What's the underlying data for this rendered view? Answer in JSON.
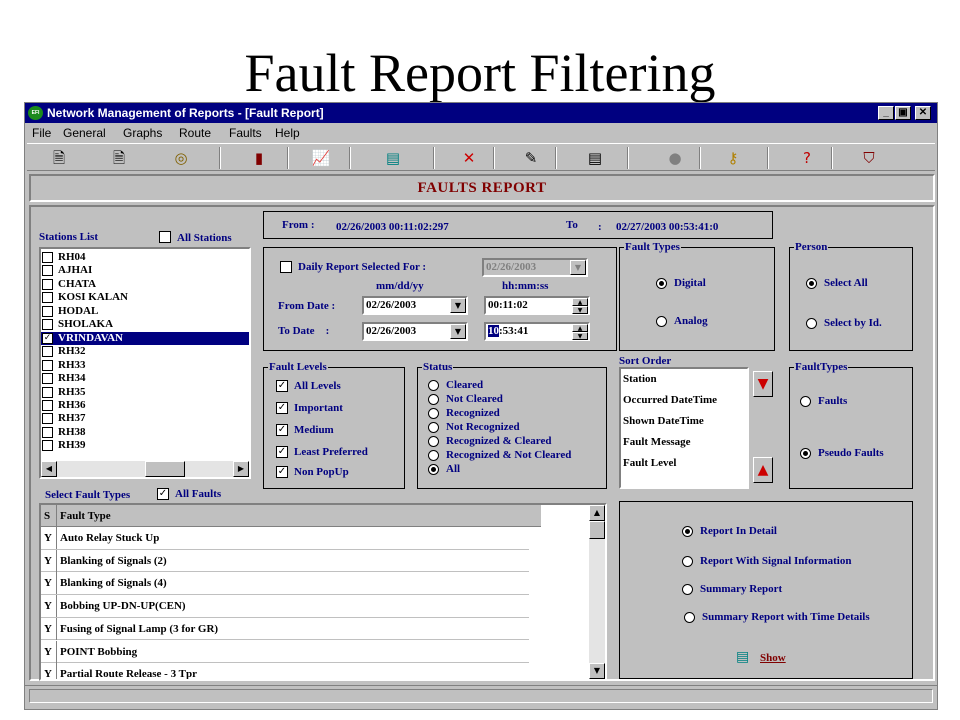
{
  "slide": {
    "title": "Fault Report Filtering"
  },
  "window": {
    "title": "Network Management of Reports  - [Fault Report]",
    "app_icon_text": "EFI",
    "buttons": {
      "minimize": "_",
      "restore": "▣",
      "close": "✕"
    }
  },
  "menu": [
    "File",
    "General",
    "Graphs",
    "Route",
    "Faults",
    "Help"
  ],
  "toolbar": [
    {
      "icon": "report-page-icon",
      "glyph": "🗎",
      "color": "#000000"
    },
    {
      "icon": "document-icon",
      "glyph": "🗎",
      "color": "#000000"
    },
    {
      "icon": "target-icon",
      "glyph": "◎",
      "color": "#806000"
    },
    {
      "icon": "bar-chart-icon",
      "glyph": "▮",
      "color": "#800000"
    },
    {
      "icon": "line-chart-icon",
      "glyph": "📈",
      "color": "#800000"
    },
    {
      "icon": "map-icon",
      "glyph": "▤",
      "color": "#008080"
    },
    {
      "icon": "delete-x-icon",
      "glyph": "✕",
      "color": "#cc0000"
    },
    {
      "icon": "edit-report-icon",
      "glyph": "✎",
      "color": "#000000"
    },
    {
      "icon": "text-page-icon",
      "glyph": "▤",
      "color": "#000000"
    },
    {
      "icon": "lock-icon",
      "glyph": "●",
      "color": "#808080"
    },
    {
      "icon": "key-icon",
      "glyph": "⚷",
      "color": "#b08000"
    },
    {
      "icon": "help-icon",
      "glyph": "?",
      "color": "#c00000"
    },
    {
      "icon": "exit-icon",
      "glyph": "⛉",
      "color": "#800000"
    }
  ],
  "header": {
    "title": "FAULTS  REPORT"
  },
  "range": {
    "from_label": "From :",
    "from_value": "02/26/2003 00:11:02:297",
    "to_label": "To",
    "to_colon": ":",
    "to_value": "02/27/2003 00:53:41:0"
  },
  "stations": {
    "label": "Stations List",
    "all_label": "All Stations",
    "all_checked": false,
    "items": [
      {
        "name": "RH04",
        "checked": false
      },
      {
        "name": "AJHAI",
        "checked": false
      },
      {
        "name": "CHATA",
        "checked": false
      },
      {
        "name": "KOSI KALAN",
        "checked": false
      },
      {
        "name": "HODAL",
        "checked": false
      },
      {
        "name": "SHOLAKA",
        "checked": false
      },
      {
        "name": "VRINDAVAN",
        "checked": true,
        "selected": true
      },
      {
        "name": "RH32",
        "checked": false
      },
      {
        "name": "RH33",
        "checked": false
      },
      {
        "name": "RH34",
        "checked": false
      },
      {
        "name": "RH35",
        "checked": false
      },
      {
        "name": "RH36",
        "checked": false
      },
      {
        "name": "RH37",
        "checked": false
      },
      {
        "name": "RH38",
        "checked": false
      },
      {
        "name": "RH39",
        "checked": false
      }
    ]
  },
  "dates": {
    "daily_label": "Daily Report Selected For :",
    "daily_value": "02/26/2003",
    "date_format": "mm/dd/yy",
    "time_format": "hh:mm:ss",
    "from_label": "From Date :",
    "from_date": "02/26/2003",
    "from_time": "00:11:02",
    "to_label": "To Date    :",
    "to_date": "02/26/2003",
    "to_time_highlight": "10",
    "to_time_rest": ":53:41"
  },
  "fault_types": {
    "label": "Fault Types",
    "options": [
      "Digital",
      "Analog"
    ],
    "selected": 0
  },
  "person": {
    "label": "Person",
    "options": [
      "Select All",
      "Select by Id."
    ],
    "selected": 0
  },
  "fault_levels": {
    "label": "Fault Levels",
    "items": [
      {
        "label": "All Levels",
        "checked": true
      },
      {
        "label": "Important",
        "checked": true
      },
      {
        "label": "Medium",
        "checked": true
      },
      {
        "label": "Least Preferred",
        "checked": true
      },
      {
        "label": "Non PopUp",
        "checked": true
      }
    ]
  },
  "status": {
    "label": "Status",
    "options": [
      "Cleared",
      "Not Cleared",
      "Recognized",
      "Not Recognized",
      "Recognized & Cleared",
      "Recognized & Not Cleared",
      "All"
    ],
    "selected": 6
  },
  "sort_order": {
    "label": "Sort Order",
    "items": [
      "Station",
      "Occurred DateTime",
      "Shown DateTime",
      "Fault Message",
      "Fault Level"
    ]
  },
  "fault_kind": {
    "label": "FaultTypes",
    "options": [
      "Faults",
      "Pseudo Faults"
    ],
    "selected": 1
  },
  "fault_table": {
    "select_label": "Select Fault Types",
    "all_label": "All Faults",
    "all_checked": true,
    "col_s": "S",
    "col_type": "Fault Type",
    "rows": [
      {
        "s": "Y",
        "type": "Auto Relay Stuck Up"
      },
      {
        "s": "Y",
        "type": "Blanking of Signals (2)"
      },
      {
        "s": "Y",
        "type": "Blanking of Signals (4)"
      },
      {
        "s": "Y",
        "type": "Bobbing UP-DN-UP(CEN)"
      },
      {
        "s": "Y",
        "type": "Fusing of Signal Lamp (3 for GR)"
      },
      {
        "s": "Y",
        "type": "POINT Bobbing"
      },
      {
        "s": "Y",
        "type": "Partial Route Release - 3 Tpr"
      }
    ]
  },
  "report": {
    "options": [
      "Report In Detail",
      "Report With Signal Information",
      "Summary Report",
      "Summary Report with Time Details"
    ],
    "selected": 0,
    "show_label": "Show"
  },
  "colors": {
    "titlebar": "#000080",
    "header_text": "#800000",
    "show_link": "#800000"
  }
}
